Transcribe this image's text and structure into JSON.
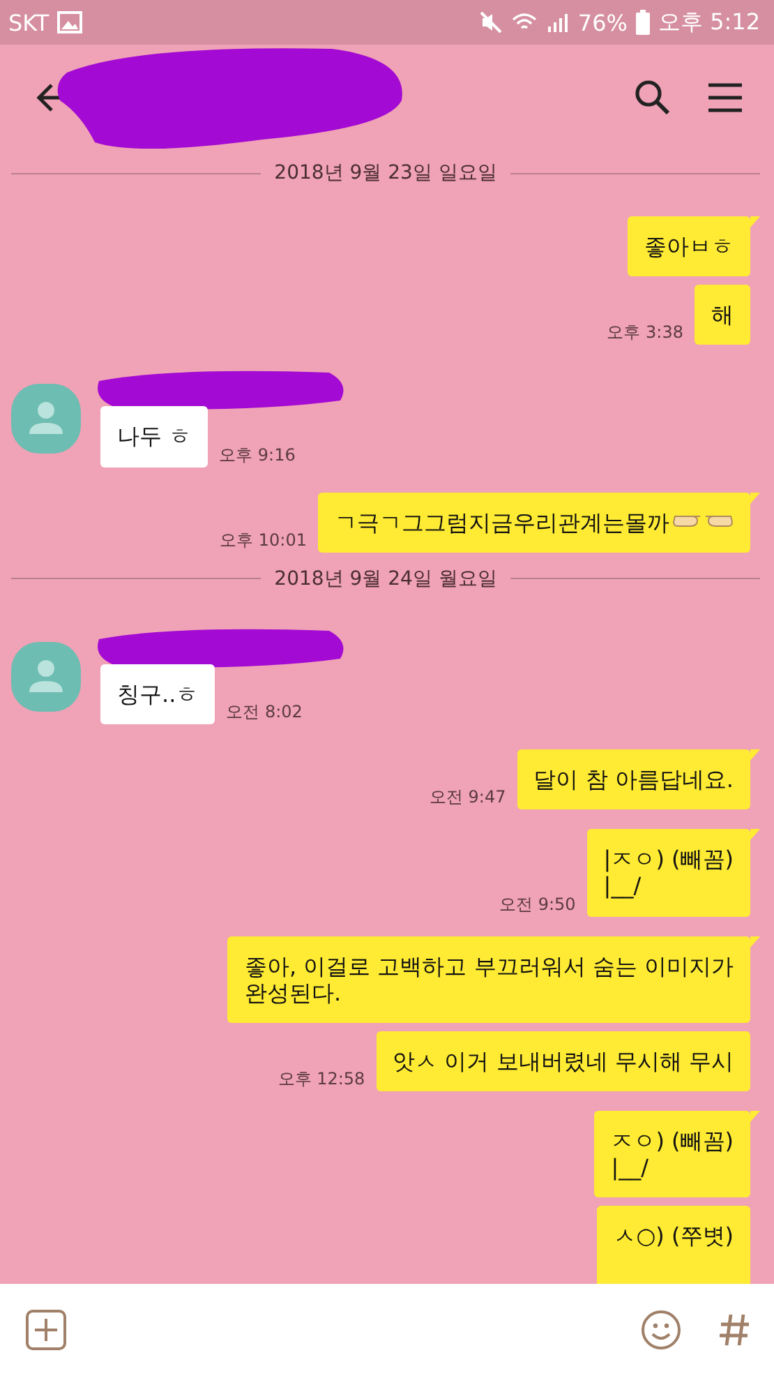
{
  "status_bar": {
    "carrier": "SKT",
    "battery": "76%",
    "time": "오후 5:12"
  },
  "messages": [
    {
      "kind": "date",
      "text": "2018년 9월 23일 일요일"
    },
    {
      "kind": "sent",
      "text": "좋아ㅂㅎ",
      "tail": true
    },
    {
      "kind": "sent",
      "text": "해",
      "time": "오후 3:38",
      "tail": false
    },
    {
      "kind": "received",
      "text": "나두 ㅎ",
      "time": "오후 9:16"
    },
    {
      "kind": "sent",
      "text": "ㄱ극ㄱ그그럼지금우리관계는몰까",
      "hands": true,
      "time": "오후 10:01",
      "tail": true
    },
    {
      "kind": "date",
      "text": "2018년 9월 24일 월요일"
    },
    {
      "kind": "received",
      "text": "칭구..ㅎ",
      "time": "오전 8:02"
    },
    {
      "kind": "sent",
      "text": "달이 참 아름답네요.",
      "time": "오전 9:47",
      "tail": true
    },
    {
      "kind": "sent",
      "text": "|ㅈㅇ) (빼꼼)\n|__/",
      "time": "오전 9:50",
      "tail": true
    },
    {
      "kind": "sent",
      "text": "좋아, 이걸로 고백하고 부끄러워서 숨는 이미지가\n완성된다.",
      "tail": true
    },
    {
      "kind": "sent",
      "text": "앗ㅅ 이거 보내버렸네 무시해 무시",
      "time": "오후 12:58",
      "tail": false
    },
    {
      "kind": "sent",
      "text": "ㅈㅇ) (빼꼼)\n|__/",
      "tail": true
    },
    {
      "kind": "sent",
      "text": "ㅅ○) (쭈볏)",
      "tail": false,
      "cut": true
    }
  ]
}
